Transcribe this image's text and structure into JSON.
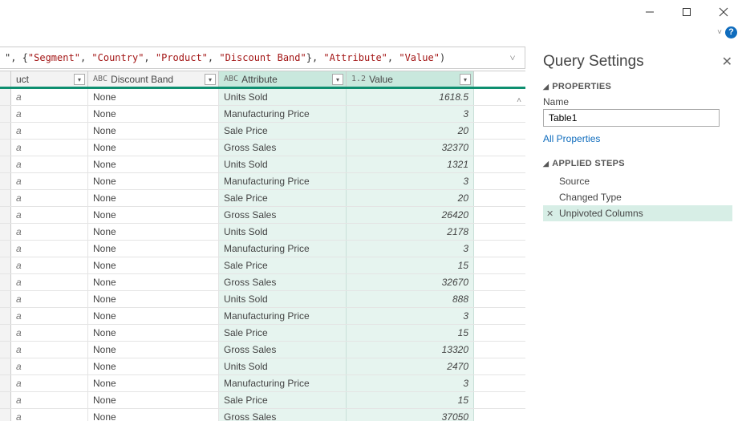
{
  "window_controls": {
    "minimize": "—",
    "maximize": "❐",
    "close": "✕"
  },
  "help": {
    "chevron": "˅",
    "question": "?"
  },
  "formula": {
    "prefix": "\", {",
    "s1": "\"Segment\"",
    "c1": ", ",
    "s2": "\"Country\"",
    "c2": ", ",
    "s3": "\"Product\"",
    "c3": ", ",
    "s4": "\"Discount Band\"",
    "suffix1": "}, ",
    "s5": "\"Attribute\"",
    "c4": ", ",
    "s6": "\"Value\"",
    "suffix2": ")"
  },
  "columns": {
    "c1": {
      "dtype": "",
      "label": "uct"
    },
    "c2": {
      "dtype": "ABC",
      "label": "Discount Band"
    },
    "c3": {
      "dtype": "ABC",
      "label": "Attribute"
    },
    "c4": {
      "dtype": "1.2",
      "label": "Value"
    }
  },
  "rows": [
    {
      "p": "a",
      "db": "None",
      "attr": "Units Sold",
      "val": "1618.5"
    },
    {
      "p": "a",
      "db": "None",
      "attr": "Manufacturing Price",
      "val": "3"
    },
    {
      "p": "a",
      "db": "None",
      "attr": "Sale Price",
      "val": "20"
    },
    {
      "p": "a",
      "db": "None",
      "attr": "Gross Sales",
      "val": "32370"
    },
    {
      "p": "a",
      "db": "None",
      "attr": "Units Sold",
      "val": "1321"
    },
    {
      "p": "a",
      "db": "None",
      "attr": "Manufacturing Price",
      "val": "3"
    },
    {
      "p": "a",
      "db": "None",
      "attr": "Sale Price",
      "val": "20"
    },
    {
      "p": "a",
      "db": "None",
      "attr": "Gross Sales",
      "val": "26420"
    },
    {
      "p": "a",
      "db": "None",
      "attr": "Units Sold",
      "val": "2178"
    },
    {
      "p": "a",
      "db": "None",
      "attr": "Manufacturing Price",
      "val": "3"
    },
    {
      "p": "a",
      "db": "None",
      "attr": "Sale Price",
      "val": "15"
    },
    {
      "p": "a",
      "db": "None",
      "attr": "Gross Sales",
      "val": "32670"
    },
    {
      "p": "a",
      "db": "None",
      "attr": "Units Sold",
      "val": "888"
    },
    {
      "p": "a",
      "db": "None",
      "attr": "Manufacturing Price",
      "val": "3"
    },
    {
      "p": "a",
      "db": "None",
      "attr": "Sale Price",
      "val": "15"
    },
    {
      "p": "a",
      "db": "None",
      "attr": "Gross Sales",
      "val": "13320"
    },
    {
      "p": "a",
      "db": "None",
      "attr": "Units Sold",
      "val": "2470"
    },
    {
      "p": "a",
      "db": "None",
      "attr": "Manufacturing Price",
      "val": "3"
    },
    {
      "p": "a",
      "db": "None",
      "attr": "Sale Price",
      "val": "15"
    },
    {
      "p": "a",
      "db": "None",
      "attr": "Gross Sales",
      "val": "37050"
    }
  ],
  "panel": {
    "title": "Query Settings",
    "properties_label": "PROPERTIES",
    "name_label": "Name",
    "name_value": "Table1",
    "all_props": "All Properties",
    "steps_label": "APPLIED STEPS",
    "steps": [
      {
        "label": "Source",
        "active": false,
        "deletable": false
      },
      {
        "label": "Changed Type",
        "active": false,
        "deletable": false
      },
      {
        "label": "Unpivoted Columns",
        "active": true,
        "deletable": true
      }
    ]
  }
}
